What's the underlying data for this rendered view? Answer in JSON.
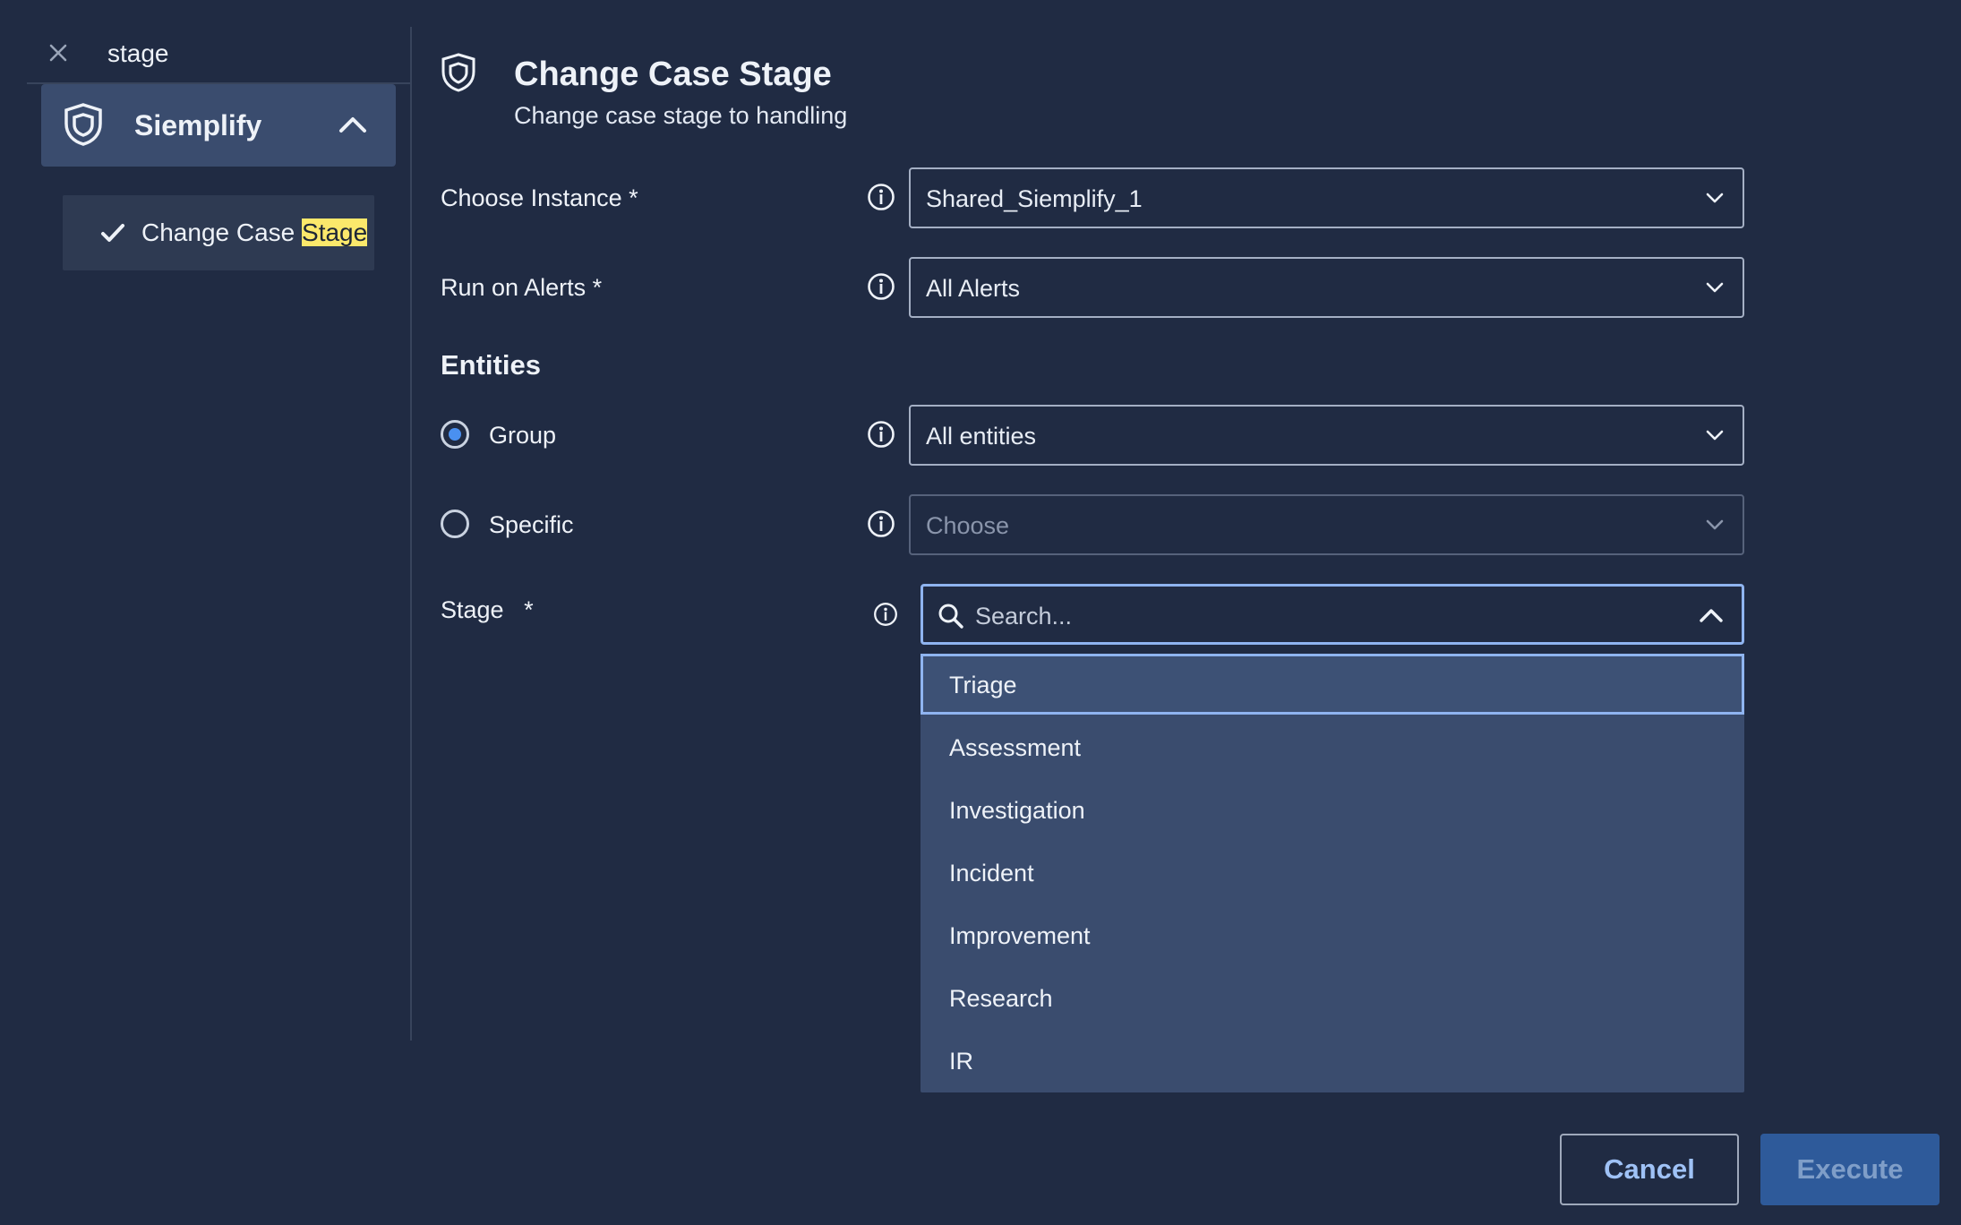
{
  "search": {
    "query": "stage"
  },
  "results_group": {
    "title": "Siemplify",
    "items": [
      {
        "prefix": "Change Case ",
        "highlight": "Stage"
      }
    ]
  },
  "action": {
    "title": "Change Case Stage",
    "subtitle": "Change case stage to handling"
  },
  "form": {
    "choose_instance": {
      "label": "Choose Instance *",
      "value": "Shared_Siemplify_1"
    },
    "run_on_alerts": {
      "label": "Run on Alerts *",
      "value": "All Alerts"
    },
    "entities_title": "Entities",
    "group": {
      "label": "Group",
      "value": "All entities",
      "selected": true
    },
    "specific": {
      "label": "Specific",
      "placeholder": "Choose",
      "selected": false
    },
    "stage": {
      "label": "Stage   *",
      "search_placeholder": "Search...",
      "options": [
        "Triage",
        "Assessment",
        "Investigation",
        "Incident",
        "Improvement",
        "Research",
        "IR"
      ],
      "highlighted_option": "Triage"
    }
  },
  "buttons": {
    "cancel": "Cancel",
    "execute": "Execute"
  },
  "colors": {
    "background": "#202b43",
    "panel": "#3a4c6e",
    "accent": "#4a90f0",
    "focus_border": "#8fb4f0",
    "highlight": "#fbe86b"
  },
  "icons": {
    "close": "close-icon",
    "shield": "shield-icon",
    "chevron_up": "chevron-up-icon",
    "chevron_down": "chevron-down-icon",
    "check": "check-icon",
    "info": "info-icon",
    "search": "search-icon"
  }
}
